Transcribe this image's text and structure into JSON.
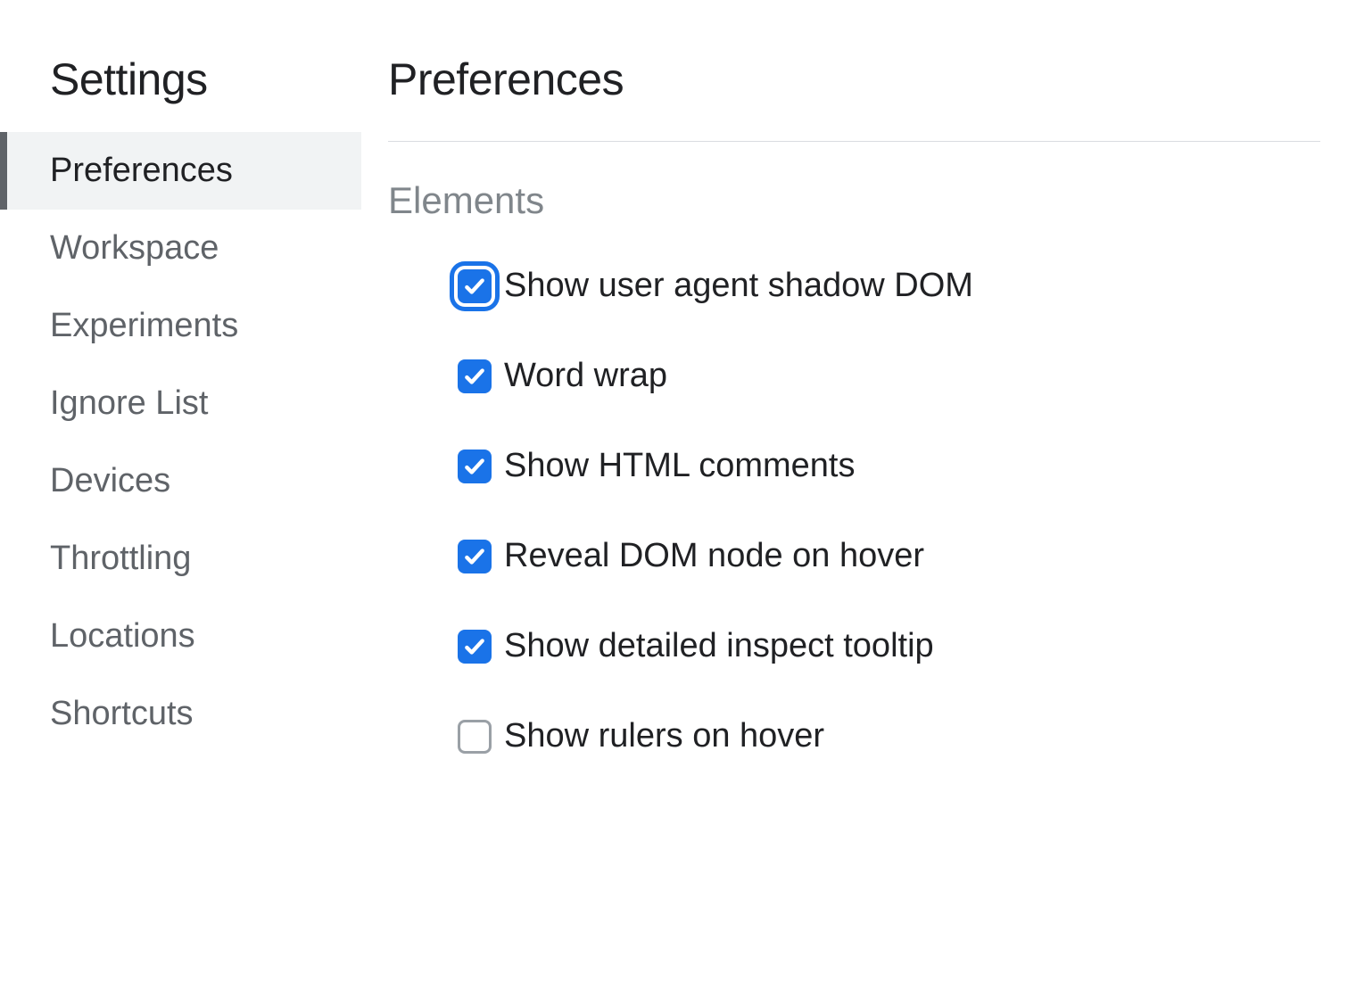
{
  "sidebar": {
    "title": "Settings",
    "items": [
      {
        "label": "Preferences",
        "selected": true
      },
      {
        "label": "Workspace",
        "selected": false
      },
      {
        "label": "Experiments",
        "selected": false
      },
      {
        "label": "Ignore List",
        "selected": false
      },
      {
        "label": "Devices",
        "selected": false
      },
      {
        "label": "Throttling",
        "selected": false
      },
      {
        "label": "Locations",
        "selected": false
      },
      {
        "label": "Shortcuts",
        "selected": false
      }
    ]
  },
  "main": {
    "title": "Preferences",
    "section": {
      "title": "Elements",
      "options": [
        {
          "label": "Show user agent shadow DOM",
          "checked": true,
          "focused": true
        },
        {
          "label": "Word wrap",
          "checked": true,
          "focused": false
        },
        {
          "label": "Show HTML comments",
          "checked": true,
          "focused": false
        },
        {
          "label": "Reveal DOM node on hover",
          "checked": true,
          "focused": false
        },
        {
          "label": "Show detailed inspect tooltip",
          "checked": true,
          "focused": false
        },
        {
          "label": "Show rulers on hover",
          "checked": false,
          "focused": false
        }
      ]
    }
  },
  "colors": {
    "accent": "#1a73e8",
    "text": "#202124",
    "muted": "#5f6368",
    "section": "#80868b",
    "selected_bg": "#f1f3f4",
    "divider": "#dadce0"
  }
}
